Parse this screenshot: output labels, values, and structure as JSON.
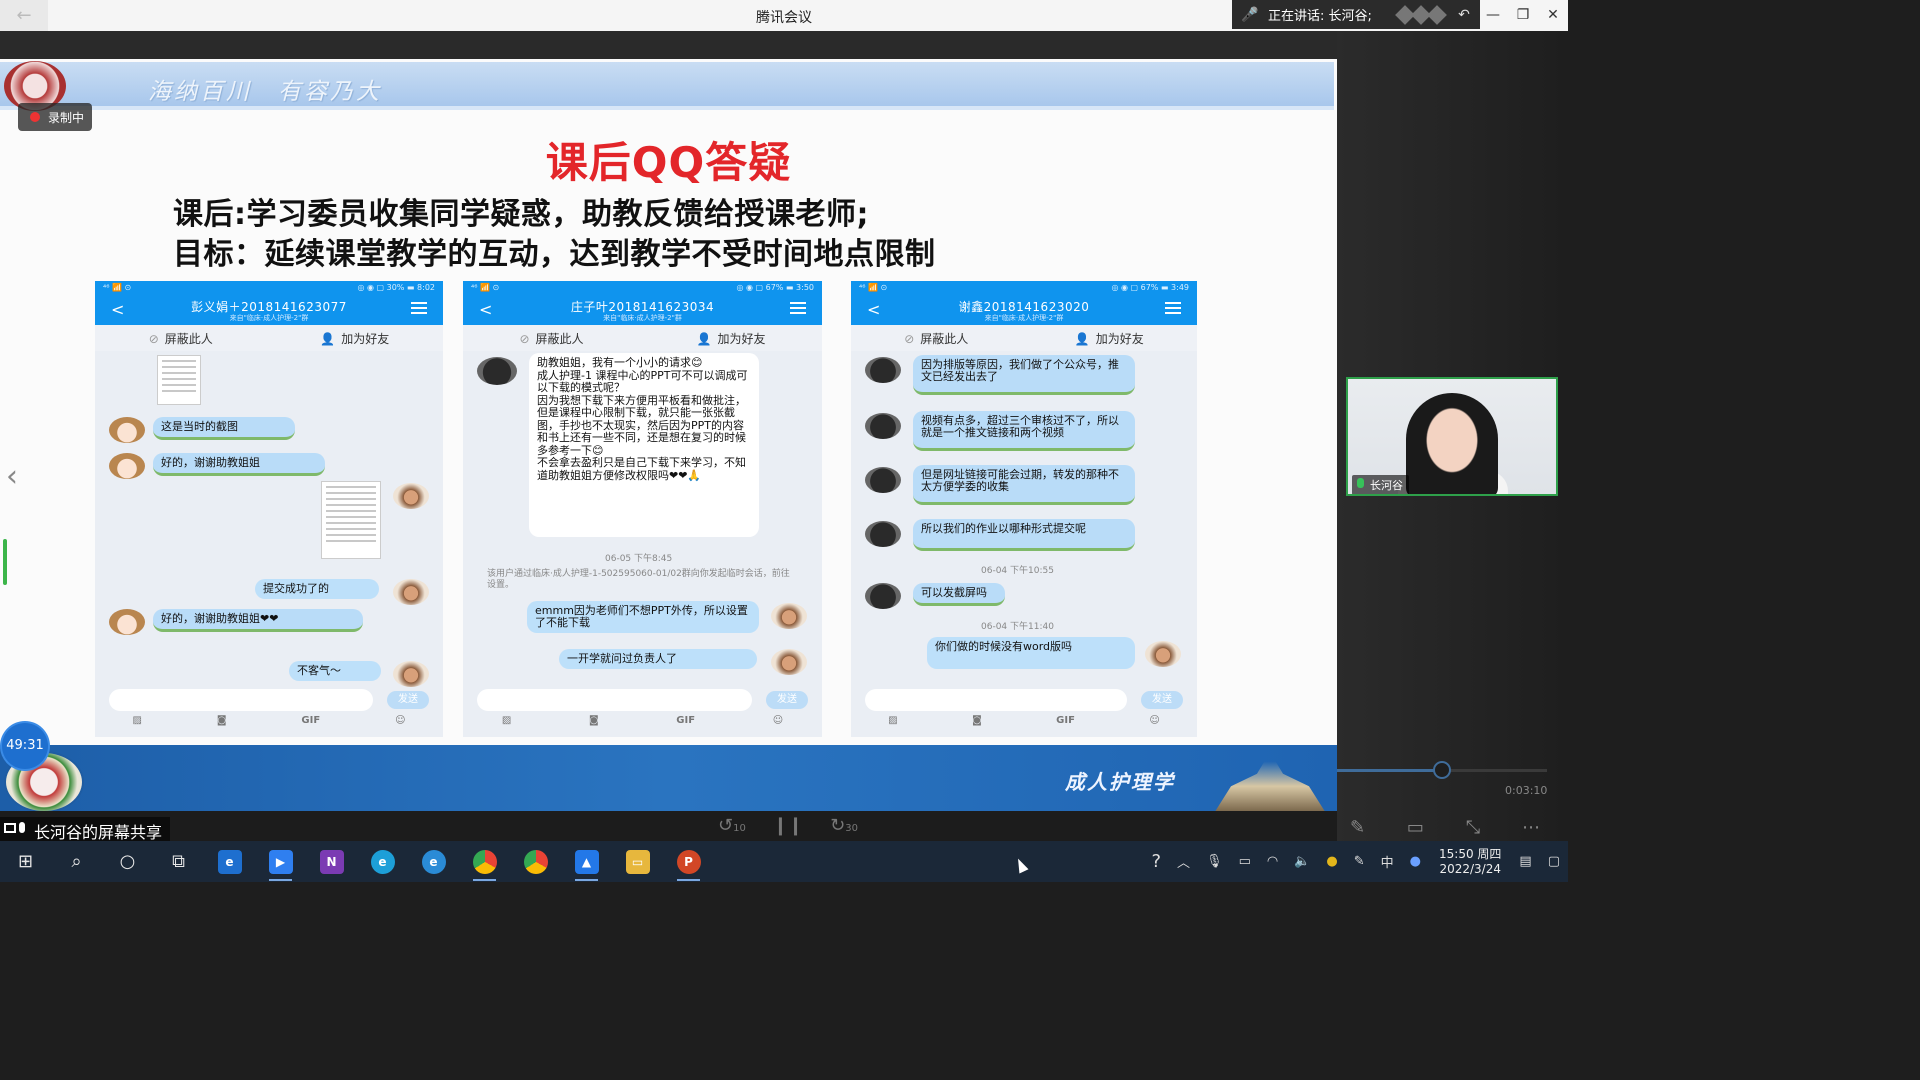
{
  "app": {
    "title": "腾讯会议",
    "speaking_label": "正在讲话: 长河谷;"
  },
  "slide": {
    "motto": "海纳百川　有容乃大",
    "recording": "录制中",
    "title": "课后QQ答疑",
    "line1": "课后:学习委员收集同学疑惑，助教反馈给授课老师;",
    "line2": "目标：延续课堂教学的互动，达到教学不受时间地点限制",
    "footer_text": "成人护理学"
  },
  "phones": [
    {
      "status_left": "⁴⁶ 📶 ⊙",
      "status_right": "◎ ◉ ▢ 30% ▬ 8:02",
      "contact": "彭义娟＋2018141623077",
      "subtitle": "来自\"临床·成人护理-2\"群",
      "block": "屏蔽此人",
      "add": "加为好友",
      "messages": {
        "m1": "这是当时的截图",
        "m2": "好的，谢谢助教姐姐",
        "m3": "提交成功了的",
        "m4": "好的，谢谢助教姐姐❤❤",
        "m5": "不客气～"
      },
      "send": "发送",
      "gif": "GIF"
    },
    {
      "status_left": "⁴⁶ 📶 ⊙",
      "status_right": "◎ ◉ ▢ 67% ▬ 3:50",
      "contact": "庄子叶2018141623034",
      "subtitle": "来自\"临床·成人护理-2\"群",
      "block": "屏蔽此人",
      "add": "加为好友",
      "messages": {
        "m1": "助教姐姐，我有一个小小的请求😊\n成人护理-1 课程中心的PPT可不可以调成可以下载的模式呢？\n因为我想下载下来方便用平板看和做批注，但是课程中心限制下载，就只能一张张截图，手抄也不太现实，然后因为PPT的内容和书上还有一些不同，还是想在复习的时候多参考一下😊\n不会拿去盈利只是自己下载下来学习，不知道助教姐姐方便修改权限吗❤❤🙏",
        "time1": "06-05 下午8:45",
        "notice": "该用户通过临床·成人护理-1-502595060-01/02群向你发起临时会话，前往设置。",
        "m2": "emmm因为老师们不想PPT外传，所以设置了不能下载",
        "m3": "一开学就问过负责人了"
      },
      "send": "发送",
      "gif": "GIF"
    },
    {
      "status_left": "⁴⁶ 📶 ⊙",
      "status_right": "◎ ◉ ▢ 67% ▬ 3:49",
      "contact": "谢鑫2018141623020",
      "subtitle": "来自\"临床·成人护理-2\"群",
      "block": "屏蔽此人",
      "add": "加为好友",
      "messages": {
        "m1": "因为排版等原因，我们做了个公众号，推文已经发出去了",
        "m2": "视频有点多，超过三个审核过不了，所以就是一个推文链接和两个视频",
        "m3": "但是网址链接可能会过期，转发的那种不太方便学委的收集",
        "m4": "所以我们的作业以哪种形式提交呢",
        "time1": "06-04 下午10:55",
        "m5": "可以发截屏吗",
        "time2": "06-04 下午11:40",
        "m6": "你们做的时候没有word版吗"
      },
      "send": "发送",
      "gif": "GIF"
    }
  ],
  "meeting": {
    "timer": "49:31",
    "share_label": "长河谷的屏幕共享",
    "participant": "长河谷",
    "elapsed": "0:03:10",
    "seek_progress": 0.5,
    "rewind": "10",
    "forward": "30"
  },
  "taskbar": {
    "ime": "中",
    "time": "15:50 周四",
    "date": "2022/3/24"
  },
  "colors": {
    "title_red": "#e3262a",
    "qq_blue": "#0f94ee",
    "footer_blue": "#1f64b2",
    "active_green": "#2ea04a"
  }
}
